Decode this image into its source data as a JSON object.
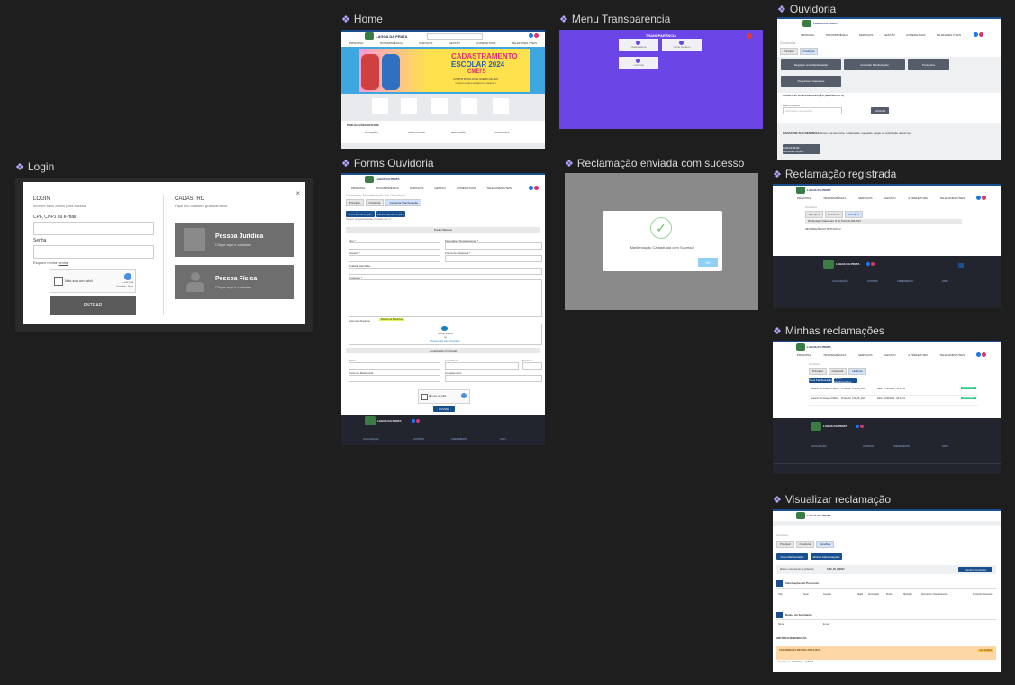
{
  "frames": {
    "login": "Login",
    "home": "Home",
    "menu_transparencia": "Menu Transparencia",
    "ouvidoria": "Ouvidoria",
    "forms_ouvidoria": "Forms Ouvidoria",
    "reclamacao_enviada": "Reclamação enviada com sucesso",
    "reclamacao_registrada": "Reclamação registrada",
    "minhas_reclamacoes": "Minhas reclamações",
    "visualizar_reclamacao": "Visualizar reclamação"
  },
  "login": {
    "title": "LOGIN",
    "subtitle": "Informe seus dados para acessar",
    "cpf_label": "CPF, CNPJ ou e-mail",
    "senha_label": "Senha",
    "forgot_prefix": "Esqueci minha",
    "forgot_link": "senha",
    "captcha": "Não sou um robô",
    "captcha_brand": "reCAPTCHA",
    "captcha_terms": "Privacidade - Termos",
    "entrar": "ENTRAR",
    "close": "×",
    "cadastro_title": "CADASTRO",
    "cadastro_subtitle": "Faça seu cadastro gratuitamente",
    "pj_title": "Pessoa Jurídica",
    "pj_sub": "Clique aqui e cadastre",
    "pf_title": "Pessoa Física",
    "pf_sub": "Clique aqui e cadastre"
  },
  "home": {
    "brand": "LAGOA DA PRATA",
    "nav": [
      "PRINCIPAL",
      "TRANSPARÊNCIA",
      "SERVIÇOS",
      "GESTÃO",
      "A PREFEITURA",
      "TELEFONES ÚTEIS"
    ],
    "banner_line1": "CADASTRAMENTO",
    "banner_line2": "ESCOLAR 2024",
    "banner_line3": "CMEI'S",
    "banner_date": "A PARTIR DO DIA 18 DE JANEIRO DE 2024",
    "banner_note": "CONSULTE DATAS E HORÁRIOS DE CADASTRO",
    "section_title": "PUBLICAÇÕES OFICIAIS",
    "pubs": [
      "LICITAÇÕES",
      "DIÁRIO OFICIAL",
      "LEGISLAÇÃO",
      "CONCURSOS"
    ]
  },
  "menu": {
    "title": "TRANSPARÊNCIA",
    "items": [
      "TRANSPARÊNCIA",
      "PORTAL DE DADOS",
      "OUVIDORIA"
    ]
  },
  "ouvidoria": {
    "breadcrumb": "Ouvidoria",
    "tabs": [
      "Principal",
      "Ouvidoria"
    ],
    "buttons": [
      "Registrar uma Manifestação",
      "Consultar Manifestação",
      "Protocolos",
      "Perguntas Frequentes"
    ],
    "consulta_title": "CONSULTA DA MANIFESTAÇÃO (PROTOCOLO)",
    "protocolo_label": "PROTOCOLO",
    "protocolo_placeholder": "Informe aqui seu protocolo",
    "buscar": "BUSCAR",
    "cadastro_title": "CADASTRE SUA DENÚNCIA:",
    "cadastro_text": "Envie sua denúncia, reclamação, sugestão, elogio ou solicitação de serviço.",
    "cadastrar_btn": "CADASTRAR MANIFESTAÇÃO"
  },
  "forms": {
    "title": "Cadastrar Manifestação na Ouvidoria",
    "tabs": [
      "Principal",
      "Ouvidoria",
      "Cadastrar Manifestação"
    ],
    "btn_nova": "Nova Manifestação",
    "btn_minhas": "Minhas Manifestações",
    "note": "Campos obrigatórios estão marcados com (*)",
    "section_dados": "Dados Básicos",
    "tipo": "Tipo *",
    "secretaria": "Secretaria / Departamento *",
    "assunto": "Assunto *",
    "forma_resposta": "Forma de Resposta *",
    "unidade": "Unidade Atendida",
    "conteudo": "Conteúdo *",
    "anexos": "Anexos / Arquivos",
    "anexos_tag": "Máximo de 5 arquivos",
    "upload_text": "Anexar arquivo",
    "upload_or": "ou",
    "upload_link": "Procure pelo seu computador",
    "section_local": "Localização (Opcional)",
    "bairro": "Bairro",
    "logradouro": "Logradouro",
    "numero": "Número",
    "ponto_ref": "Ponto de Referência",
    "complemento": "Complemento",
    "captcha": "Não sou um robô",
    "enviar": "ENVIAR"
  },
  "success": {
    "message": "Manifestação Cadastrada com Sucesso!",
    "ok": "OK"
  },
  "registrada": {
    "breadcrumb": "Ouvidoria",
    "tabs": [
      "Principal",
      "Ouvidoria",
      "Detalhes"
    ],
    "protocol_label": "Manifestação Cadastrada: Nº do Protocolo",
    "protocol": "366-2024",
    "info": "INFORMAÇÕES DO PROTOCOLO"
  },
  "minhas": {
    "breadcrumb": "Ouvidoria",
    "tabs": [
      "Principal",
      "Ouvidoria",
      "Histórico"
    ],
    "btn_nova": "Nova Manifestação",
    "btn_minhas": "Minhas Manifestações",
    "rows": [
      {
        "assunto": "Assunto: Iluminação Pública",
        "protocolo": "Protocolo: 375_26_2024",
        "data": "Data: 17/06/2024 - 09:14:35",
        "status": "Em Análise"
      },
      {
        "assunto": "Assunto: Iluminação Pública",
        "protocolo": "Protocolo: 374_26_2024",
        "data": "Data: 12/06/2024 - 08:13:21",
        "status": "Em Análise"
      }
    ]
  },
  "visualizar": {
    "breadcrumb": "Ouvidoria",
    "tabs": [
      "Principal",
      "Ouvidoria",
      "Detalhes"
    ],
    "btn_nova": "Nova Manifestação",
    "btn_minhas": "Minhas Manifestações",
    "protocolo_label": "Abaixo o documento do protocolo:",
    "protocolo": "1360_26_102024",
    "imprimir": "Imprimir protocolo",
    "info_title": "Informações do Protocolo",
    "cols": [
      "Tipo",
      "Setor",
      "Assunto",
      "Sigilo",
      "Anonimato",
      "Prazo",
      "Situação",
      "Secretaria / Departamento",
      "Protocolo Relevante"
    ],
    "solicitante_title": "Dados do Solicitante",
    "nome_label": "Nome",
    "email_label": "E-mail",
    "historico_title": "HISTÓRICO DE INTERAÇÃO",
    "alerta_label": "CONFIRMAÇÃO ENVIADA POR E-MAIL",
    "alerta_status": "Em Análise",
    "alerta_date": "Enviada em: 17/06/2024 - 14:53:18"
  },
  "footer": {
    "localizacao": "LOCALIZAÇÃO",
    "contato": "CONTATO",
    "atendimento": "ATENDIMENTO",
    "cnpj": "CNPJ"
  },
  "colors": {
    "canvas": "#1e1e1e",
    "label": "#d9d9d9",
    "accent": "#b9a6ff",
    "brand_blue": "#1a4f8f",
    "purple": "#6b45e6"
  }
}
